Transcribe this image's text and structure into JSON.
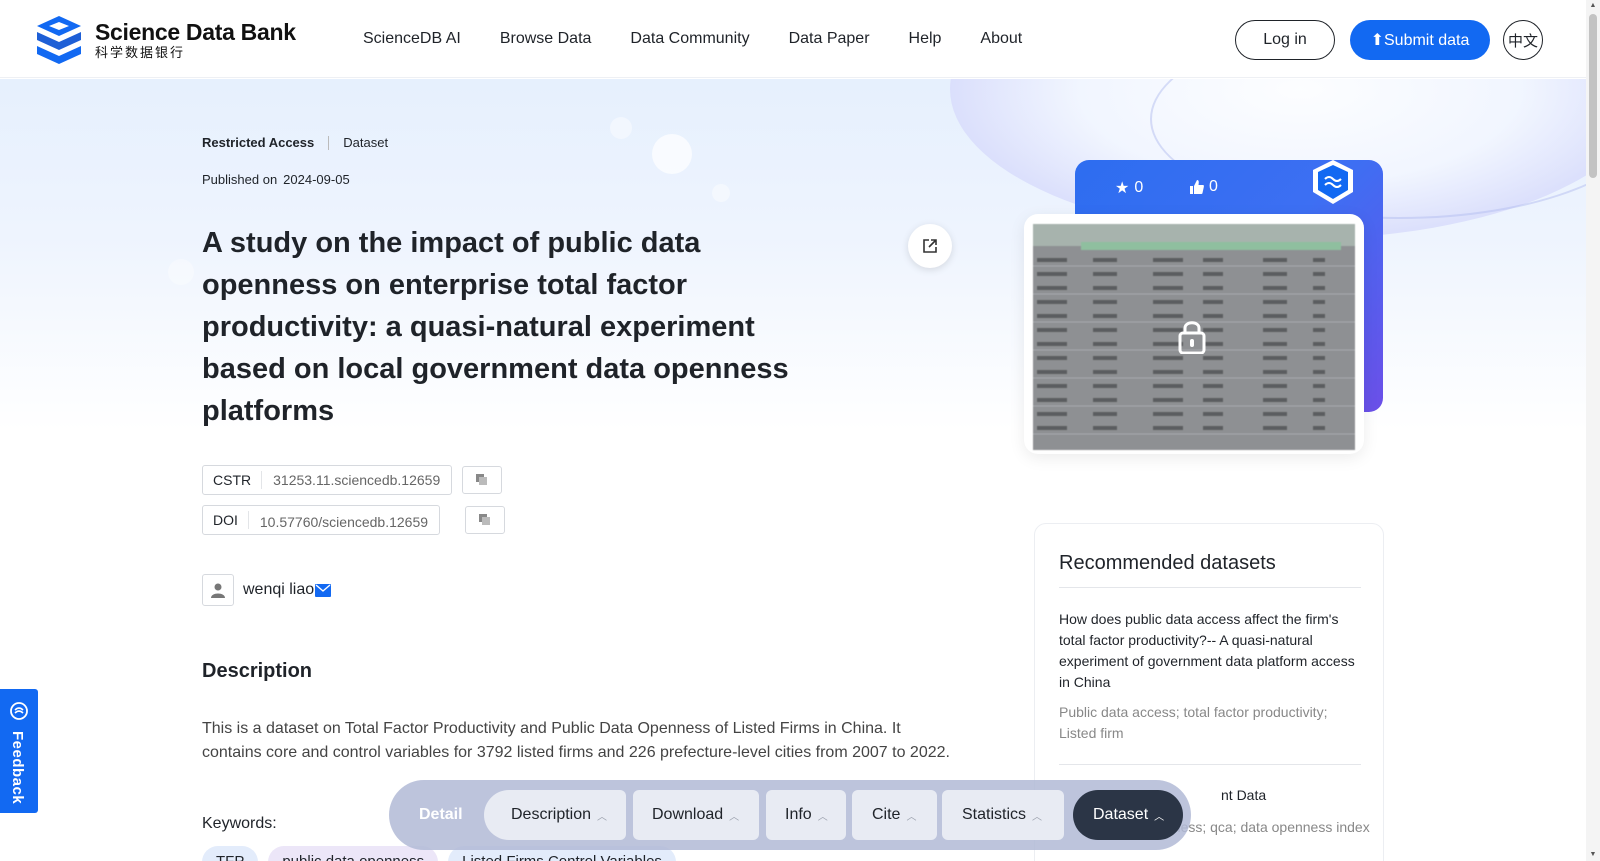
{
  "brand": {
    "name_en": "Science Data Bank",
    "name_cn": "科学数据银行"
  },
  "nav": {
    "items": [
      "ScienceDB AI",
      "Browse Data",
      "Data Community",
      "Data Paper",
      "Help",
      "About"
    ]
  },
  "header_actions": {
    "login": "Log in",
    "submit": "Submit data",
    "lang": "中文"
  },
  "dataset": {
    "access": "Restricted Access",
    "type": "Dataset",
    "published_label": "Published on",
    "published_date": "2024-09-05",
    "title": "A study on the impact of public data openness on enterprise total factor productivity: a quasi-natural experiment based on local government data openness platforms",
    "cstr_label": "CSTR",
    "cstr_value": "31253.11.sciencedb.12659",
    "doi_label": "DOI",
    "doi_value": "10.57760/sciencedb.12659",
    "author": "wenqi liao",
    "description_heading": "Description",
    "description": "This is a dataset on Total Factor Productivity and Public Data Openness of Listed Firms in China. It contains core and control variables for 3792 listed firms and 226 prefecture-level cities from 2007 to 2022.",
    "keywords_heading": "Keywords:",
    "keywords": [
      "TFP",
      "public data openness",
      "Listed Firms Control Variables"
    ],
    "keyword_colors": [
      "#e3ecfb",
      "#ece6f8",
      "#e3ecfb"
    ]
  },
  "stats": {
    "stars": "0",
    "likes": "0"
  },
  "recommended": {
    "heading": "Recommended datasets",
    "item1_title": "How does public data access affect the firm's total factor productivity?-- A quasi-natural experiment of government data platform access in China",
    "item1_keywords": "Public data access; total factor productivity; Listed firm",
    "item2_title": "nt Data",
    "item2_keywords": "nness; qca; data openness index"
  },
  "feedback": "Feedback",
  "floatnav": {
    "detail": "Detail",
    "tabs": [
      "Description",
      "Download",
      "Info",
      "Cite",
      "Statistics"
    ],
    "active": "Dataset"
  },
  "colors": {
    "brand_blue": "#1269f2",
    "dark": "#2b3546"
  },
  "icons": [
    "logo-mark",
    "share-icon",
    "copy-icon",
    "user-icon",
    "mail-icon",
    "star-icon",
    "thumbs-up-icon",
    "shield-icon",
    "lock-icon",
    "feedback-icon",
    "chevron-up-icon",
    "upload-icon"
  ]
}
